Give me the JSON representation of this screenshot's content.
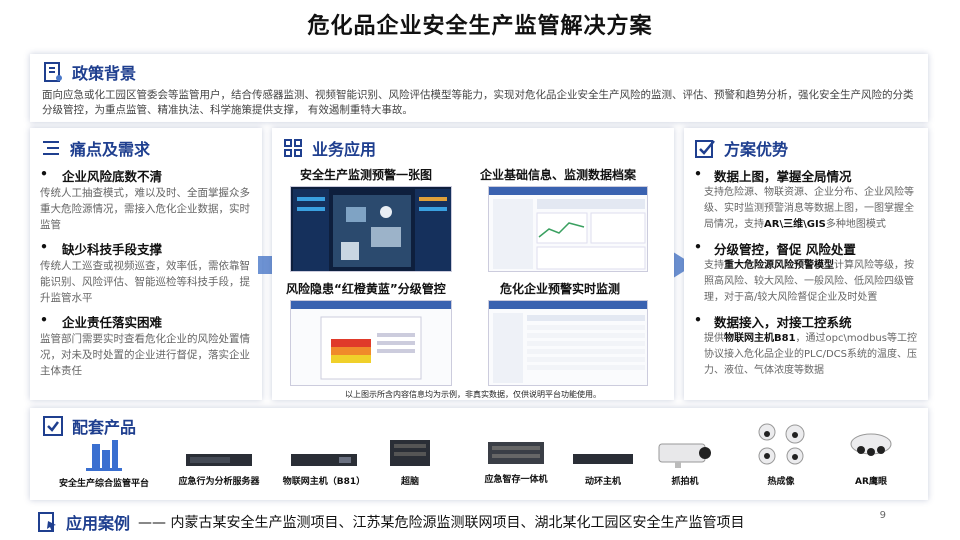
{
  "title": "危化品企业安全生产监管解决方案",
  "policy": {
    "heading": "政策背景",
    "text": "面向应急或化工园区管委会等监管用户，结合传感器监测、视频智能识别、风险评估模型等能力，实现对危化品企业安全生产风险的监测、评估、预警和趋势分析，强化安全生产风险的分类分级管控，为重点监管、精准执法、科学施策提供支撑， 有效遏制重特大事故。"
  },
  "pain": {
    "heading": "痛点及需求",
    "items": [
      {
        "title": "企业风险底数不清",
        "desc": "传统人工抽查模式，难以及时、全面掌握众多重大危险源情况，需接入危化企业数据，实时监管"
      },
      {
        "title": "缺少科技手段支撑",
        "desc": "传统人工巡查或视频巡查，效率低，需依靠智能识别、风险评估、智能巡检等科技手段，提升监管水平"
      },
      {
        "title": "企业责任落实困难",
        "desc": "监管部门需要实时查看危化企业的风险处置情况，对未及时处置的企业进行督促，落实企业主体责任"
      }
    ]
  },
  "biz": {
    "heading": "业务应用",
    "captions": [
      "安全生产监测预警一张图",
      "企业基础信息、监测数据档案",
      "风险隐患“红橙黄蓝”分级管控",
      "危化企业预警实时监测"
    ],
    "note": "以上图示所含内容信息均为示例，非真实数据，仅供说明平台功能使用。"
  },
  "adv": {
    "heading": "方案优势",
    "items": [
      {
        "title": "数据上图，掌握全局情况",
        "pre": "支持危险源、物联资源、企业分布、企业风险等级、实时监测预警消息等数据上图，一图掌握全局情况，支持",
        "bold": "AR\\三维\\GIS",
        "post": "多种地图模式"
      },
      {
        "title": "分级管控，督促 风险处置",
        "pre": "支持",
        "bold": "重大危险源风险预警模型",
        "post": "计算风险等级，按照高风险、较大风险、一般风险、低风险四级管理，对于高/较大风险督促企业及时处置"
      },
      {
        "title": "数据接入，对接工控系统",
        "pre": "提供",
        "bold": "物联网主机B81",
        "post": "，通过opc\\modbus等工控协议接入危化品企业的PLC/DCS系统的温度、压力、液位、气体浓度等数据"
      }
    ]
  },
  "products": {
    "heading": "配套产品",
    "items": [
      "安全生产综合监管平台",
      "应急行为分析服务器",
      "物联网主机（B81）",
      "超脑",
      "应急智存一体机",
      "动环主机",
      "抓拍机",
      "热成像",
      "AR鹰眼"
    ]
  },
  "cases": {
    "heading": "应用案例",
    "text": "—— 内蒙古某安全生产监测项目、江苏某危险源监测联网项目、湖北某化工园区安全生产监管项目"
  },
  "page_number": "9",
  "colors": {
    "accent": "#1f3f8f",
    "arrow": "#4a78c8"
  }
}
